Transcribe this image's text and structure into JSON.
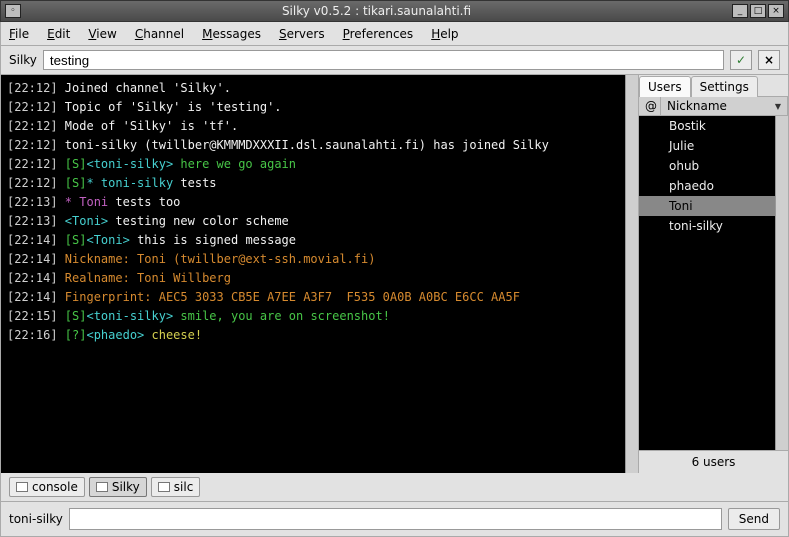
{
  "window": {
    "title": "Silky v0.5.2 : tikari.saunalahti.fi"
  },
  "menu": {
    "file": "File",
    "edit": "Edit",
    "view": "View",
    "channel": "Channel",
    "messages": "Messages",
    "servers": "Servers",
    "preferences": "Preferences",
    "help": "Help"
  },
  "topic": {
    "label": "Silky",
    "value": "testing",
    "accept": "✓",
    "close": "×"
  },
  "right_tabs": {
    "users": "Users",
    "settings": "Settings"
  },
  "userlist_header": {
    "at": "@",
    "nick": "Nickname"
  },
  "users": [
    {
      "nick": "Bostik",
      "sel": false
    },
    {
      "nick": "Julie",
      "sel": false
    },
    {
      "nick": "ohub",
      "sel": false
    },
    {
      "nick": "phaedo",
      "sel": false
    },
    {
      "nick": "Toni",
      "sel": true
    },
    {
      "nick": "toni-silky",
      "sel": false
    }
  ],
  "usercount": "6 users",
  "bottom_tabs": [
    {
      "label": "console",
      "active": false
    },
    {
      "label": "Silky",
      "active": true
    },
    {
      "label": "silc",
      "active": false
    }
  ],
  "entry": {
    "nick": "toni-silky",
    "value": "",
    "send": "Send"
  },
  "chat": [
    {
      "ts": "22:12",
      "segs": [
        {
          "t": "Joined channel 'Silky'.",
          "c": "c-w"
        }
      ]
    },
    {
      "ts": "22:12",
      "segs": [
        {
          "t": "Topic of 'Silky' is 'testing'.",
          "c": "c-w"
        }
      ]
    },
    {
      "ts": "22:12",
      "segs": [
        {
          "t": "Mode of 'Silky' is 'tf'.",
          "c": "c-w"
        }
      ]
    },
    {
      "ts": "22:12",
      "segs": [
        {
          "t": "toni-silky (twillber@KMMMDXXXII.dsl.saunalahti.fi) has joined Silky",
          "c": "c-w"
        }
      ],
      "wrap": true
    },
    {
      "ts": "22:12",
      "segs": [
        {
          "t": "[S]",
          "c": "c-g"
        },
        {
          "t": "<toni-silky>",
          "c": "c-cy"
        },
        {
          "t": " here we go again",
          "c": "c-g"
        }
      ]
    },
    {
      "ts": "22:12",
      "segs": [
        {
          "t": "[S]",
          "c": "c-g"
        },
        {
          "t": "* toni-silky",
          "c": "c-cy"
        },
        {
          "t": " tests",
          "c": "c-w"
        }
      ]
    },
    {
      "ts": "22:13",
      "segs": [
        {
          "t": "* Toni",
          "c": "c-mg"
        },
        {
          "t": " tests too",
          "c": "c-w"
        }
      ]
    },
    {
      "ts": "22:13",
      "segs": [
        {
          "t": "<Toni>",
          "c": "c-cy"
        },
        {
          "t": " testing new color scheme",
          "c": "c-w"
        }
      ]
    },
    {
      "ts": "22:14",
      "segs": [
        {
          "t": "[S]",
          "c": "c-g"
        },
        {
          "t": "<Toni>",
          "c": "c-cy"
        },
        {
          "t": " this is signed message",
          "c": "c-w"
        }
      ]
    },
    {
      "ts": "22:14",
      "segs": [
        {
          "t": "Nickname: Toni (twillber@ext-ssh.movial.fi)",
          "c": "c-or"
        }
      ]
    },
    {
      "ts": "22:14",
      "segs": [
        {
          "t": "Realname: Toni Willberg",
          "c": "c-or"
        }
      ]
    },
    {
      "ts": "22:14",
      "segs": [
        {
          "t": "Fingerprint: AEC5 3033 CB5E A7EE A3F7  F535 0A0B A0BC E6CC AA5F",
          "c": "c-or"
        }
      ]
    },
    {
      "ts": "22:15",
      "segs": [
        {
          "t": "[S]",
          "c": "c-g"
        },
        {
          "t": "<toni-silky>",
          "c": "c-cy"
        },
        {
          "t": " smile, you are on screenshot!",
          "c": "c-g"
        }
      ]
    },
    {
      "ts": "22:16",
      "segs": [
        {
          "t": "[?]",
          "c": "c-g"
        },
        {
          "t": "<phaedo>",
          "c": "c-cy"
        },
        {
          "t": " cheese!",
          "c": "c-yl"
        }
      ]
    }
  ]
}
